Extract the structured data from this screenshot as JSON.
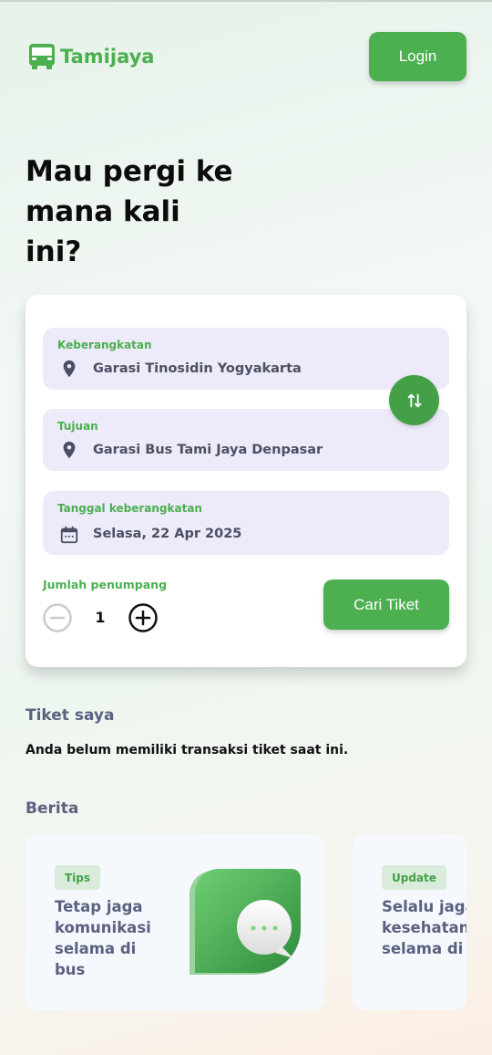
{
  "header": {
    "app_name": "Tamijaya",
    "login_label": "Login"
  },
  "hero": {
    "title": "Mau pergi ke mana kali ini?"
  },
  "booking_form": {
    "departure": {
      "label": "Keberangkatan",
      "value": "Garasi Tinosidin  Yogyakarta",
      "icon": "location-pin-icon"
    },
    "destination": {
      "label": "Tujuan",
      "value": "Garasi Bus Tami Jaya Denpasar",
      "icon": "location-pin-icon"
    },
    "date": {
      "label": "Tanggal keberangkatan",
      "value": "Selasa, 22 Apr 2025",
      "icon": "calendar-icon"
    },
    "swap_icon": "swap-vertical-icon",
    "passengers": {
      "label": "Jumlah penumpang",
      "count": "1"
    },
    "search_label": "Cari Tiket"
  },
  "my_tickets": {
    "title": "Tiket saya",
    "empty_message": "Anda belum memiliki transaksi tiket saat ini."
  },
  "news": {
    "title": "Berita",
    "items": [
      {
        "badge": "Tips",
        "title": "Tetap jaga komunikasi selama di bus"
      },
      {
        "badge": "Update",
        "title": "Selalu jaga kesehatan selama di bus"
      }
    ]
  },
  "colors": {
    "primary": "#4caf50",
    "field_bg": "#edeaf9",
    "text_muted": "#5b6180"
  }
}
